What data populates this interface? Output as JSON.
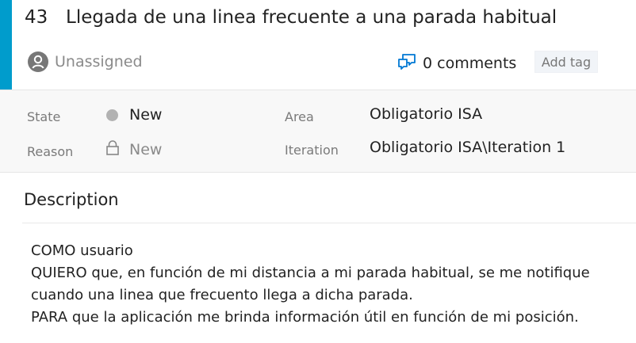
{
  "work_item": {
    "id": "43",
    "title": "Llegada de una linea frecuente a una parada habitual",
    "assignee": "Unassigned",
    "comments_label": "0 comments",
    "add_tag_label": "Add tag"
  },
  "fields": {
    "state_label": "State",
    "state_value": "New",
    "reason_label": "Reason",
    "reason_value": "New",
    "area_label": "Area",
    "area_value": "Obligatorio ISA",
    "iteration_label": "Iteration",
    "iteration_value": "Obligatorio ISA\\Iteration 1"
  },
  "description": {
    "heading": "Description",
    "lines": [
      "COMO usuario",
      "QUIERO que, en función de mi distancia a mi parada habitual, se me notifique",
      "cuando una linea que frecuento llega a dicha parada.",
      "PARA que la aplicación me brinda información útil en función de mi posición."
    ]
  },
  "colors": {
    "accent": "#009ccc",
    "state_new": "#b2b2b2",
    "comments_icon": "#0078d4"
  },
  "icons": {
    "assignee": "user-avatar-icon",
    "comments": "comments-icon",
    "reason_lock": "lock-icon"
  }
}
